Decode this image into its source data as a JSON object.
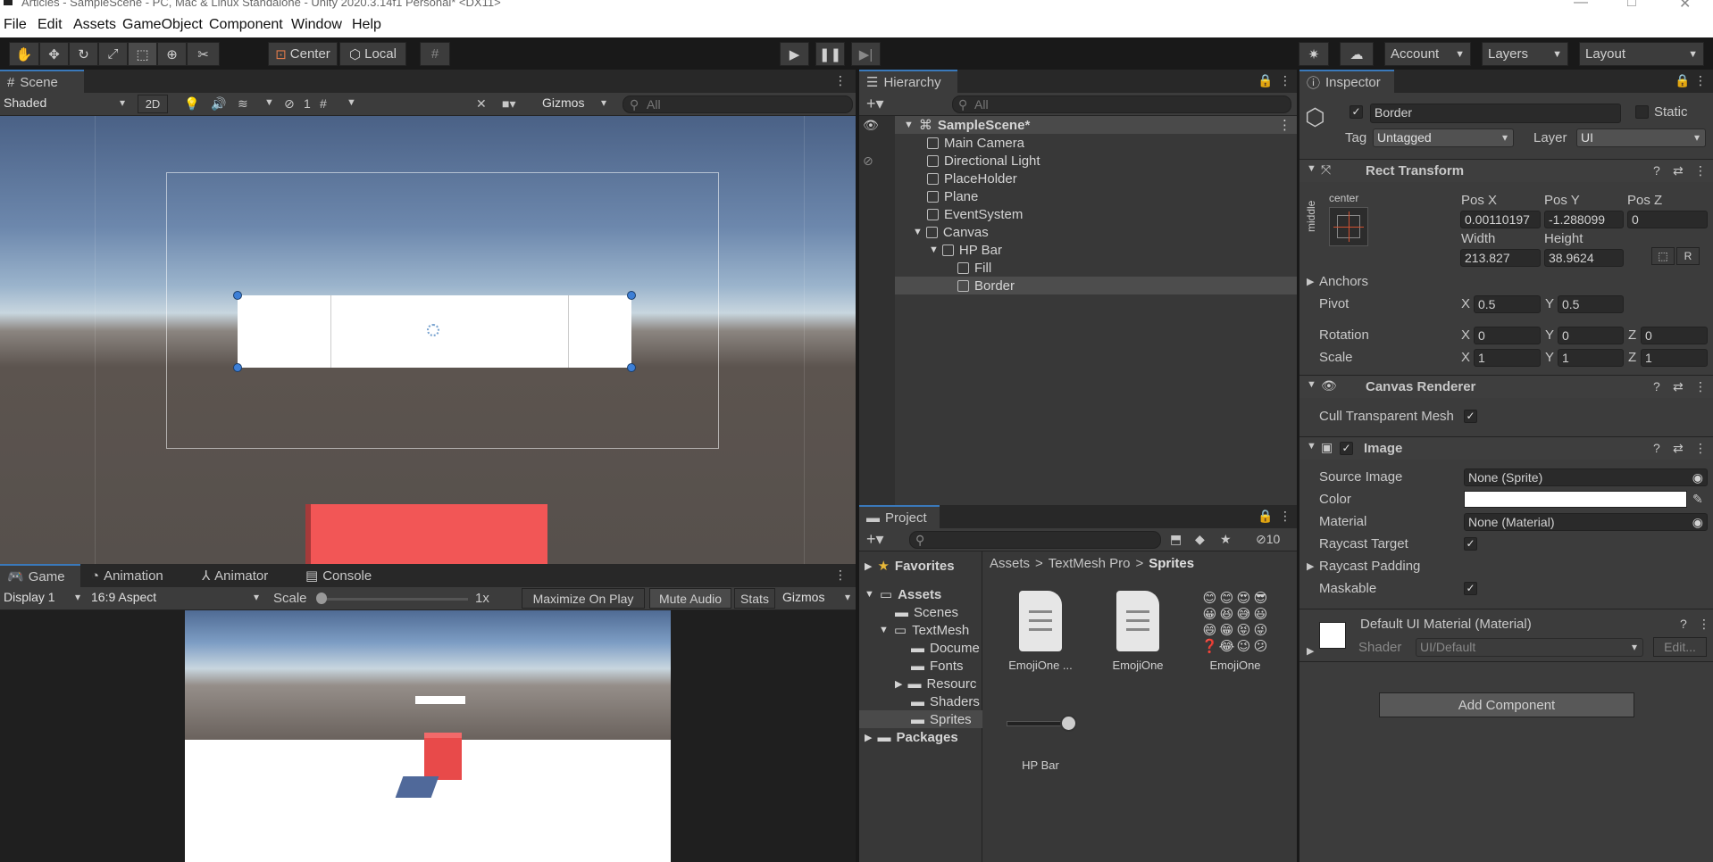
{
  "window": {
    "title": "Articles - SampleScene - PC, Mac & Linux Standalone - Unity 2020.3.14f1 Personal* <DX11>"
  },
  "menu": [
    "File",
    "Edit",
    "Assets",
    "GameObject",
    "Component",
    "Window",
    "Help"
  ],
  "toolbar": {
    "center": "Center",
    "local": "Local",
    "account": "Account",
    "layers": "Layers",
    "layout": "Layout"
  },
  "scene": {
    "tab": "Scene",
    "shading": "Shaded",
    "mode2d": "2D",
    "hidden_count": "1",
    "gizmos": "Gizmos",
    "search_placeholder": "All"
  },
  "game": {
    "tabs": [
      "Game",
      "Animation",
      "Animator",
      "Console"
    ],
    "display": "Display 1",
    "aspect": "16:9 Aspect",
    "scale_label": "Scale",
    "scale_value": "1x",
    "maximize": "Maximize On Play",
    "mute": "Mute Audio",
    "stats": "Stats",
    "gizmos": "Gizmos"
  },
  "hierarchy": {
    "tab": "Hierarchy",
    "search_placeholder": "All",
    "scene": "SampleScene*",
    "items": [
      "Main Camera",
      "Directional Light",
      "PlaceHolder",
      "Plane",
      "EventSystem",
      "Canvas",
      "HP Bar",
      "Fill",
      "Border"
    ]
  },
  "project": {
    "tab": "Project",
    "hidden_count": "10",
    "favorites": "Favorites",
    "assets": "Assets",
    "folders": [
      "Scenes",
      "TextMesh",
      "Docume",
      "Fonts",
      "Resourc",
      "Shaders",
      "Sprites"
    ],
    "packages": "Packages",
    "breadcrumb": [
      "Assets",
      "TextMesh Pro",
      "Sprites"
    ],
    "files": [
      "EmojiOne ...",
      "EmojiOne",
      "EmojiOne",
      "HP Bar"
    ]
  },
  "inspector": {
    "tab": "Inspector",
    "name": "Border",
    "static": "Static",
    "tag_label": "Tag",
    "tag": "Untagged",
    "layer_label": "Layer",
    "layer": "UI",
    "rect": {
      "title": "Rect Transform",
      "anchor_h": "center",
      "anchor_v": "middle",
      "posx_label": "Pos X",
      "posy_label": "Pos Y",
      "posz_label": "Pos Z",
      "posx": "0.00110197",
      "posy": "-1.288099",
      "posz": "0",
      "width_label": "Width",
      "height_label": "Height",
      "width": "213.827",
      "height": "38.9624",
      "r": "R",
      "anchors": "Anchors",
      "pivot": "Pivot",
      "pivot_x": "0.5",
      "pivot_y": "0.5",
      "rotation": "Rotation",
      "rot_x": "0",
      "rot_y": "0",
      "rot_z": "0",
      "scale": "Scale",
      "sc_x": "1",
      "sc_y": "1",
      "sc_z": "1",
      "x": "X",
      "y": "Y",
      "z": "Z"
    },
    "canvas_renderer": {
      "title": "Canvas Renderer",
      "cull": "Cull Transparent Mesh"
    },
    "image": {
      "title": "Image",
      "source_label": "Source Image",
      "source": "None (Sprite)",
      "color_label": "Color",
      "material_label": "Material",
      "material": "None (Material)",
      "raycast": "Raycast Target",
      "padding": "Raycast Padding",
      "maskable": "Maskable"
    },
    "material": {
      "title": "Default UI Material (Material)",
      "shader_label": "Shader",
      "shader": "UI/Default",
      "edit": "Edit..."
    },
    "add_component": "Add Component"
  }
}
